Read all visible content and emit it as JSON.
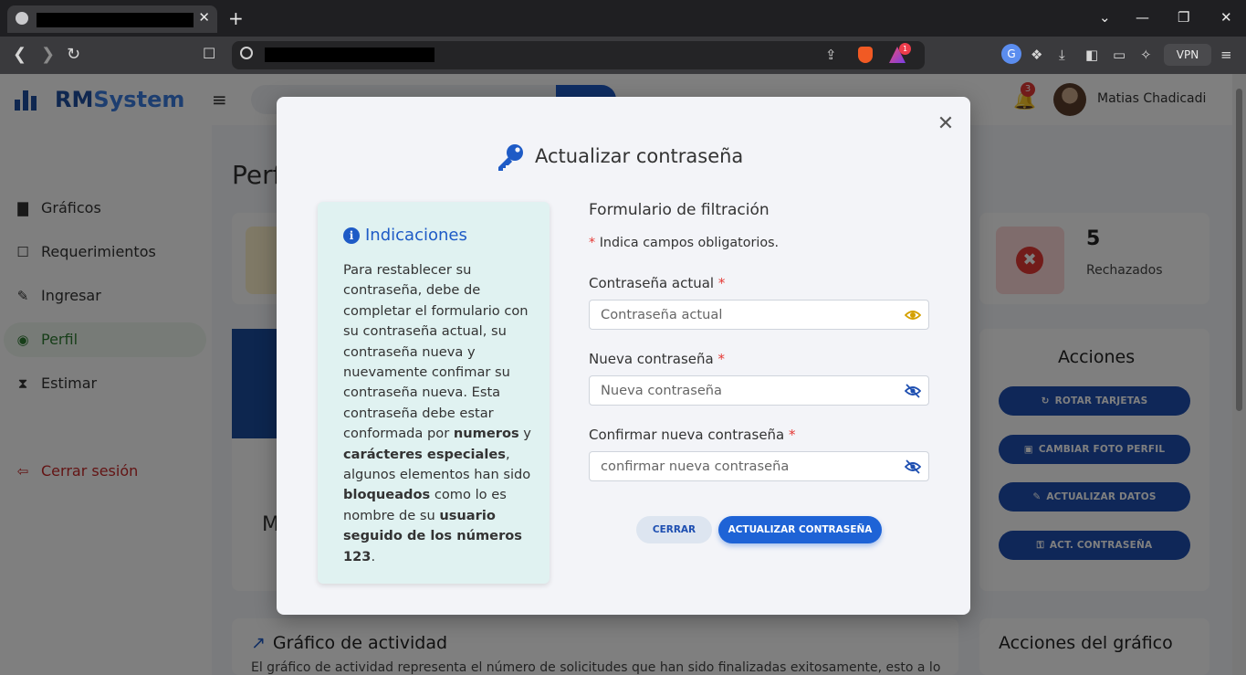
{
  "browser": {
    "tab_close": "✕",
    "new_tab": "+",
    "window_controls": [
      "⌄",
      "—",
      "❐",
      "✕"
    ],
    "rewards_badge": "1",
    "vpn_label": "VPN"
  },
  "app": {
    "brand_prefix": "RM",
    "brand_suffix": "System",
    "notification_count": "3",
    "user_name": "Matias Chadicadi"
  },
  "sidebar": {
    "items": [
      {
        "label": "Gráficos",
        "icon": "chart-icon"
      },
      {
        "label": "Requerimientos",
        "icon": "clipboard-icon"
      },
      {
        "label": "Ingresar",
        "icon": "pen-icon"
      },
      {
        "label": "Perfil",
        "icon": "user-circle-icon",
        "active": true
      },
      {
        "label": "Estimar",
        "icon": "hourglass-icon"
      }
    ],
    "logout": "Cerrar sesión"
  },
  "profile_page": {
    "title": "Perfil",
    "rejected_count": "5",
    "rejected_label": "Rechazados",
    "partial_letter": "M",
    "actions_title": "Acciones",
    "actions": [
      {
        "label": "ROTAR TARJETAS",
        "icon": "rotate-icon"
      },
      {
        "label": "CAMBIAR FOTO PERFIL",
        "icon": "camera-icon"
      },
      {
        "label": "ACTUALIZAR DATOS",
        "icon": "user-edit-icon"
      },
      {
        "label": "ACT. CONTRASEÑA",
        "icon": "key-icon"
      }
    ],
    "chart_section_title": "Gráfico de actividad",
    "chart_section_desc": "El gráfico de actividad representa el número de solicitudes que han sido finalizadas exitosamente, esto a lo",
    "chart_actions_title": "Acciones del gráfico"
  },
  "modal": {
    "title": "Actualizar contraseña",
    "info": {
      "title": "Indicaciones",
      "text_1": "Para restablecer su contraseña, debe de completar el formulario con su contraseña actual, su contraseña nueva y nuevamente confimar su contraseña nueva. Esta contraseña debe estar conformada por ",
      "bold_1": "numeros",
      "text_2": " y ",
      "bold_2": "carácteres especiales",
      "text_3": ", algunos elementos han sido ",
      "bold_3": "bloqueados",
      "text_4": " como lo es nombre de su ",
      "bold_4": "usuario seguido de los números 123",
      "text_5": "."
    },
    "form": {
      "title": "Formulario de filtración",
      "required_star": "*",
      "required_note": " Indica campos obligatorios.",
      "fields": [
        {
          "label": "Contraseña actual",
          "placeholder": "Contraseña actual",
          "value": ""
        },
        {
          "label": "Nueva contraseña",
          "placeholder": "Nueva contraseña",
          "value": ""
        },
        {
          "label": "Confirmar nueva contraseña",
          "placeholder": "confirmar nueva contraseña",
          "value": ""
        }
      ]
    },
    "buttons": {
      "close": "CERRAR",
      "submit": "ACTUALIZAR CONTRASEÑA"
    }
  },
  "colors": {
    "primary": "#1e5bc6",
    "required": "#e53935",
    "info_bg": "#e0f2f1",
    "eye_visible": "#d4a000",
    "eye_hidden": "#1e4fb1"
  }
}
